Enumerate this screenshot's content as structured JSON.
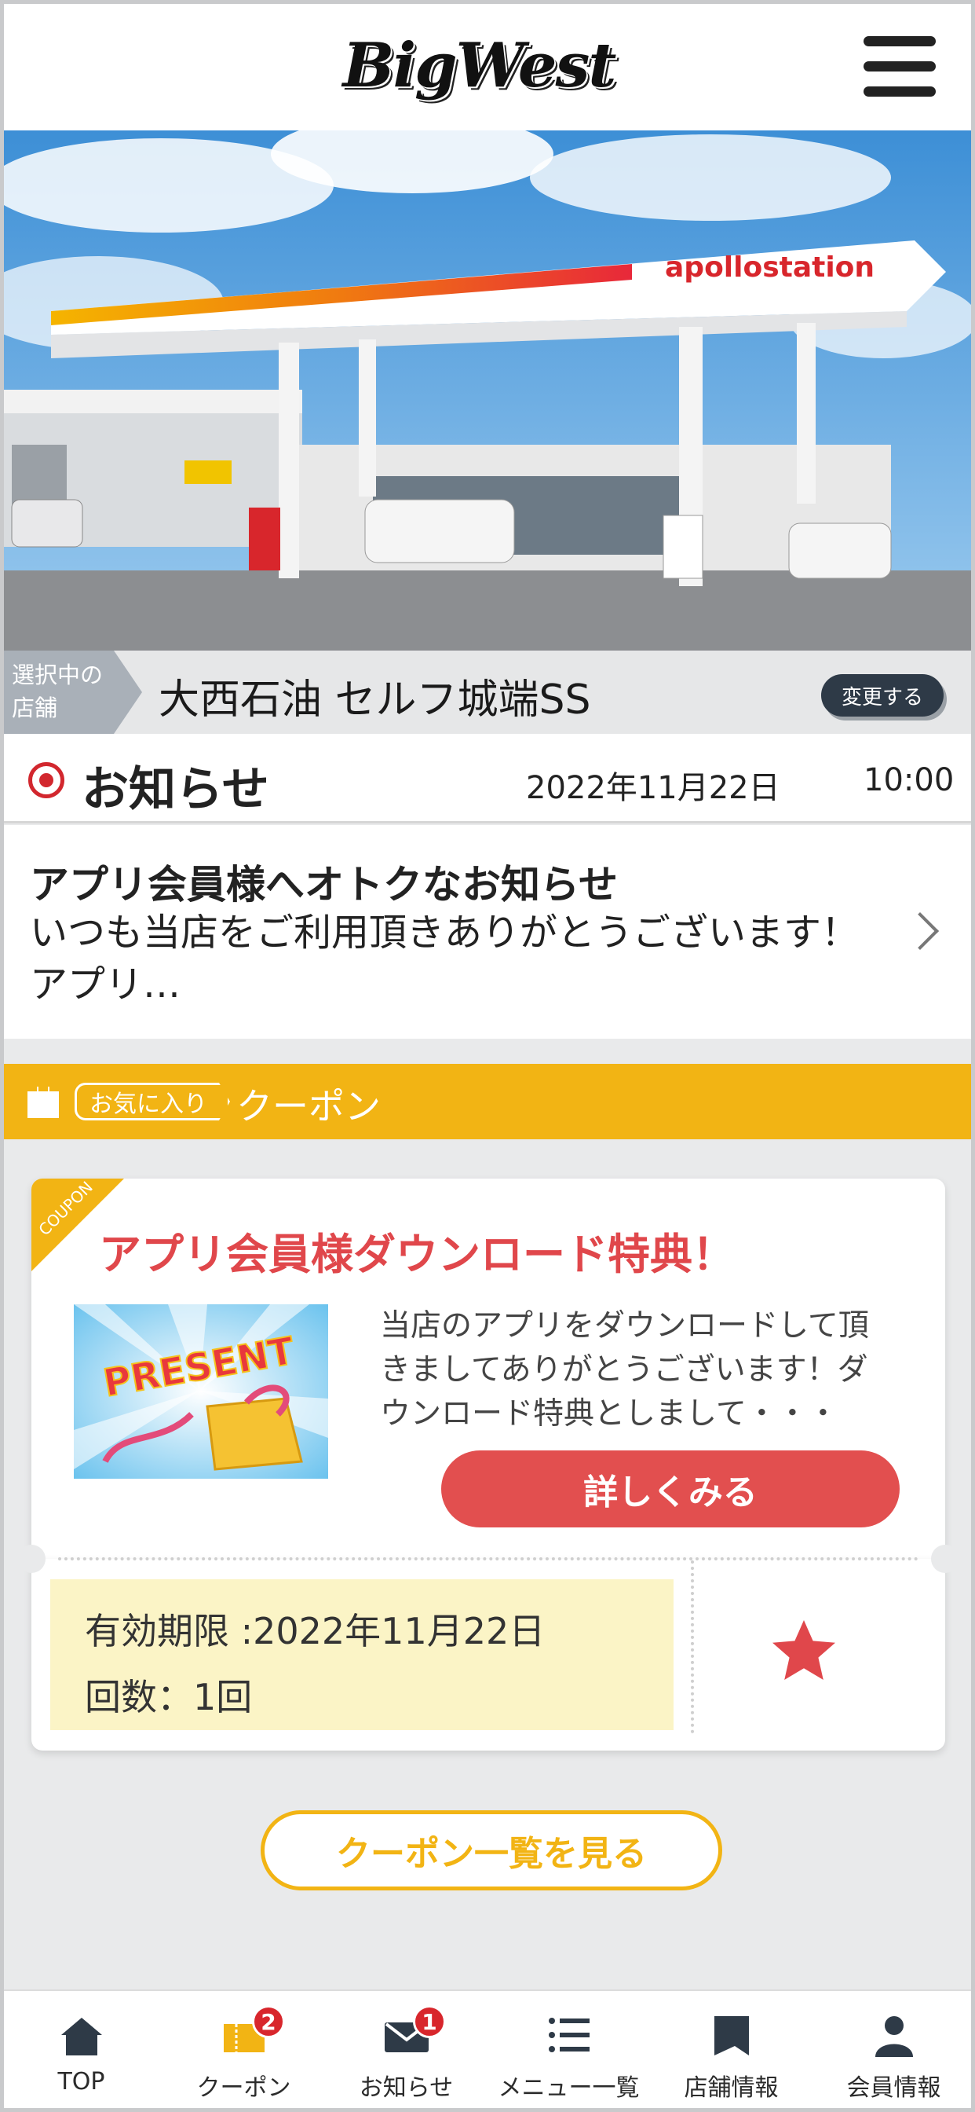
{
  "header": {
    "logo_text": "BigWest"
  },
  "hero": {
    "canopy_sign": "apollostation"
  },
  "store": {
    "tag_line1": "選択中の",
    "tag_line2": "店舗",
    "name": "大西石油 セルフ城端SS",
    "change_label": "変更する"
  },
  "news": {
    "section_title": "お知らせ",
    "date": "2022年11月22日",
    "time": "10:00",
    "item_title": "アプリ会員様へオトクなお知らせ",
    "item_body": "いつも当店をご利用頂きありがとうございます！アプリ…"
  },
  "coupon_section": {
    "favorite_tag": "お気に入り",
    "label": "クーポン"
  },
  "coupon": {
    "corner_label": "COUPON",
    "title": "アプリ会員様ダウンロード特典！",
    "image_text": "PRESENT",
    "description": "当店のアプリをダウンロードして頂きましてありがとうございます！ダウンロード特典としまして・・・",
    "detail_button": "詳しくみる",
    "expiry": "有効期限 :2022年11月22日",
    "count": "回数：1回",
    "accent_color": "#e24f4f",
    "section_color": "#f2b414"
  },
  "coupon_list_button": "クーポン一覧を見る",
  "bottom_nav": {
    "items": [
      {
        "label": "TOP",
        "icon": "home-icon"
      },
      {
        "label": "クーポン",
        "icon": "coupon-icon",
        "badge": "2"
      },
      {
        "label": "お知らせ",
        "icon": "mail-icon",
        "badge": "1"
      },
      {
        "label": "メニュー一覧",
        "icon": "menu-list-icon"
      },
      {
        "label": "店舗情報",
        "icon": "store-icon"
      },
      {
        "label": "会員情報",
        "icon": "user-icon"
      }
    ]
  }
}
